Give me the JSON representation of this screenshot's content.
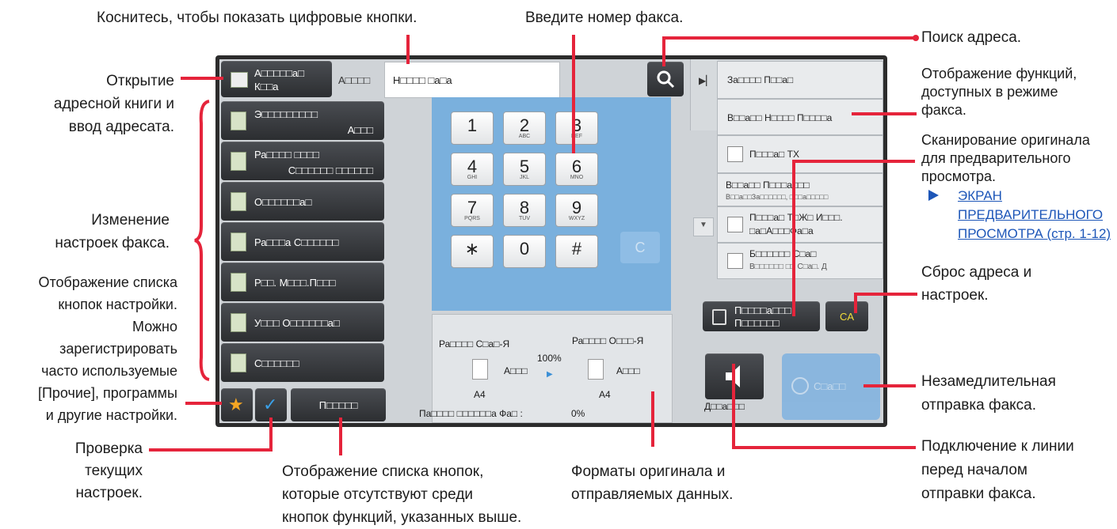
{
  "annotations": {
    "touch_keys": "Коснитесь, чтобы показать цифровые кнопки.",
    "enter_fax": "Введите номер факса.",
    "address_search": "Поиск адреса.",
    "addr_book_1": "Открытие",
    "addr_book_2": "адресной книги и",
    "addr_book_3": "ввод адресата.",
    "show_funcs_1": "Отображение функций,",
    "show_funcs_2": "доступных в режиме",
    "show_funcs_3": "факса.",
    "scan_1": "Сканирование оригинала",
    "scan_2": "для предварительного",
    "scan_3": "просмотра.",
    "link_1": "ЭКРАН",
    "link_2": "ПРЕДВАРИТЕЛЬНОГО",
    "link_3": "ПРОСМОТРА (стр. 1-12)",
    "change_1": "Изменение",
    "change_2": "настроек факса.",
    "list_1": "Отображение списка",
    "list_2": "кнопок настройки.",
    "list_3": "Можно",
    "list_4": "зарегистрировать",
    "list_5": "часто используемые",
    "list_6": "[Прочие], программы",
    "list_7": "и другие настройки.",
    "reset_1": "Сброс адреса и",
    "reset_2": "настроек.",
    "send_1": "Незамедлительная",
    "send_2": "отправка факса.",
    "check_1": "Проверка",
    "check_2": "текущих",
    "check_3": "настроек.",
    "others_1": "Отображение списка кнопок,",
    "others_2": "которые отсутствуют среди",
    "others_3": "кнопок функций, указанных выше.",
    "formats_1": "Форматы оригинала и",
    "formats_2": "отправляемых данных.",
    "line_1": "Подключение к линии",
    "line_2": "перед началом",
    "line_3": "отправки факса."
  },
  "ui": {
    "addr_book_l1": "А□□□□□а□",
    "addr_book_l2": "К□□а",
    "addr_label": "А□□□□",
    "fax_input_value": "Н□□□□ □а□а",
    "menu": [
      {
        "l1": "Э□□□□□□□□□",
        "l2": "А□□□",
        "icon": "exposure-icon"
      },
      {
        "l1": "Ра□□□□ □□□□",
        "l2": "С□□□□□□ □□□□□□",
        "icon": "resolution-icon"
      },
      {
        "l1": "О□□□□□□а□",
        "l2": "",
        "icon": "original-icon"
      },
      {
        "l1": "Ра□□□а С□□□□□□",
        "l2": "",
        "icon": "send-size-icon"
      },
      {
        "l1": "Р□□. М□□□.П□□□",
        "l2": "",
        "icon": "memory-icon"
      },
      {
        "l1": "У□□□ О□□□□□□а□",
        "l2": "",
        "icon": "count-icon"
      },
      {
        "l1": "С□□□□□□",
        "l2": "",
        "icon": "program-icon"
      }
    ],
    "others_label": "П□□□□□",
    "keys": [
      {
        "n": "1",
        "l": ""
      },
      {
        "n": "2",
        "l": "ABC"
      },
      {
        "n": "3",
        "l": "DEF"
      },
      {
        "n": "4",
        "l": "GHI"
      },
      {
        "n": "5",
        "l": "JKL"
      },
      {
        "n": "6",
        "l": "MNO"
      },
      {
        "n": "7",
        "l": "PQRS"
      },
      {
        "n": "8",
        "l": "TUV"
      },
      {
        "n": "9",
        "l": "WXYZ"
      },
      {
        "n": "∗",
        "l": ""
      },
      {
        "n": "0",
        "l": ""
      },
      {
        "n": "#",
        "l": ""
      }
    ],
    "clear_key": "C",
    "scan_size_label": "Ра□□□□ С□а□-Я",
    "send_size_label": "Ра□□□□ О□□□-Я",
    "ratio": "100%",
    "auto_left": "А□□□",
    "auto_right": "А□□□",
    "size_left": "A4",
    "size_right": "A4",
    "memory_label": "Па□□□□ □□□□□□а Фа□ :",
    "memory_value": "0%",
    "right_items": [
      "За□□□□ П□□а□",
      "В□□а□□ Н□□□□ П□□□□а"
    ],
    "print_tx": "П□□□а□ TX",
    "poll_l1": "В□□а□□ П□□□а□□□",
    "poll_l2": "В□□а□□За□□□□□□, □□□а□□□□□",
    "dual_l1": "П□□□а□ Т□Ж□ И□□□.",
    "dual_l2": "□а□А□□□Фа□а",
    "erase_l1": "Б□□□□□□ С□а□",
    "erase_l2": "В□□□□□□ □□ С□а□. Д",
    "preview_l1": "П□□□□а□□□",
    "preview_l2": "П□□□□□□",
    "ca": "CA",
    "onhook_label": "Д□□а□□□",
    "start_label": "С□а□□",
    "colors": {
      "accent": "#e5243b",
      "ca": "#f4de3a",
      "start": "#7fb2e0",
      "pad": "#7ab0dd"
    }
  }
}
